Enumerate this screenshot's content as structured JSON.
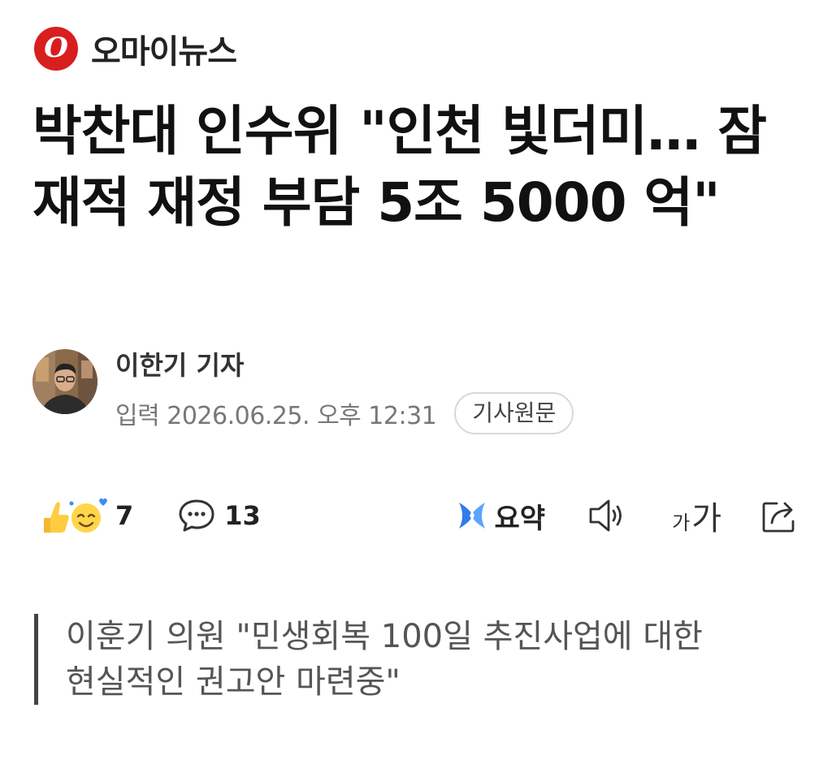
{
  "publisher": {
    "logo_letter": "O",
    "name": "오마이뉴스",
    "brand_color": "#d91e1e"
  },
  "article": {
    "headline": "박찬대 인수위 \"인천 빛더미… 잠재적 재정 부담 5조 5000 억\"",
    "reporter": "이한기 기자",
    "published": "입력 2026.06.25. 오후 12:31",
    "original_button": "기사원문",
    "subtitle_lines": [
      "이훈기 의원 \"민생회복 100일 추진사업에 대한",
      "현실적인 권고안 마련중\""
    ]
  },
  "actions": {
    "reactions_count": "7",
    "comments_count": "13",
    "summary_label": "요약",
    "font_small": "가",
    "font_large": "가",
    "icons": {
      "reactions": "reaction-emoji-icon",
      "comments": "comment-bubble-icon",
      "summary": "ai-summary-icon",
      "tts": "speaker-icon",
      "font": "font-size-icon",
      "share": "share-icon"
    },
    "summary_icon_color": "#2f7de8"
  }
}
